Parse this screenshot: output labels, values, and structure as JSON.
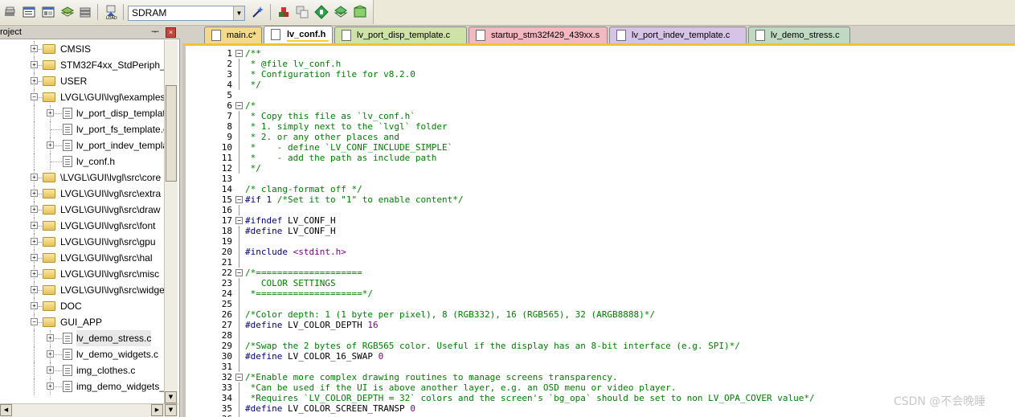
{
  "toolbar": {
    "target_select": "SDRAM",
    "icons": [
      "book-stack-icon",
      "window-icon",
      "window-list-icon",
      "layers-icon",
      "stack-icon",
      "load-icon",
      "wand-icon",
      "options-icon",
      "copy-icon",
      "diamond-icon",
      "manage-icon",
      "box-icon"
    ]
  },
  "project": {
    "title": "roject",
    "pin": "ᅮ",
    "close": "×",
    "tree": [
      {
        "type": "folder",
        "label": "CMSIS",
        "depth": 0
      },
      {
        "type": "folder",
        "label": "STM32F4xx_StdPeriph_D",
        "depth": 0
      },
      {
        "type": "folder",
        "label": "USER",
        "depth": 0
      },
      {
        "type": "folder-open",
        "label": "LVGL\\GUI\\lvgl\\examples",
        "depth": 0
      },
      {
        "type": "file",
        "label": "lv_port_disp_templat",
        "depth": 1,
        "expand": true
      },
      {
        "type": "file",
        "label": "lv_port_fs_template.c",
        "depth": 1,
        "expand": false
      },
      {
        "type": "file",
        "label": "lv_port_indev_templa",
        "depth": 1,
        "expand": true
      },
      {
        "type": "file",
        "label": "lv_conf.h",
        "depth": 1,
        "expand": false
      },
      {
        "type": "folder",
        "label": "\\LVGL\\GUI\\lvgl\\src\\core",
        "depth": 0
      },
      {
        "type": "folder",
        "label": "LVGL\\GUI\\lvgl\\src\\extra",
        "depth": 0
      },
      {
        "type": "folder",
        "label": "LVGL\\GUI\\lvgl\\src\\draw",
        "depth": 0
      },
      {
        "type": "folder",
        "label": "LVGL\\GUI\\lvgl\\src\\font",
        "depth": 0
      },
      {
        "type": "folder",
        "label": "LVGL\\GUI\\lvgl\\src\\gpu",
        "depth": 0
      },
      {
        "type": "folder",
        "label": "LVGL\\GUI\\lvgl\\src\\hal",
        "depth": 0
      },
      {
        "type": "folder",
        "label": "LVGL\\GUI\\lvgl\\src\\misc",
        "depth": 0
      },
      {
        "type": "folder",
        "label": "LVGL\\GUI\\lvgl\\src\\widge",
        "depth": 0
      },
      {
        "type": "folder",
        "label": "DOC",
        "depth": 0
      },
      {
        "type": "folder-open",
        "label": "GUI_APP",
        "depth": 0
      },
      {
        "type": "file",
        "label": "lv_demo_stress.c",
        "depth": 1,
        "expand": true,
        "selected": true
      },
      {
        "type": "file",
        "label": "lv_demo_widgets.c",
        "depth": 1,
        "expand": true
      },
      {
        "type": "file",
        "label": "img_clothes.c",
        "depth": 1,
        "expand": true
      },
      {
        "type": "file",
        "label": "img_demo_widgets_",
        "depth": 1,
        "expand": true
      }
    ]
  },
  "tabs": [
    {
      "label": "main.c*",
      "color": "#f3d98a",
      "active": false
    },
    {
      "label": "lv_conf.h",
      "color": "#ffffff",
      "active": true
    },
    {
      "label": "lv_port_disp_template.c",
      "color": "#cfe2a8",
      "active": false
    },
    {
      "label": "startup_stm32f429_439xx.s",
      "color": "#f3b9c0",
      "active": false
    },
    {
      "label": "lv_port_indev_template.c",
      "color": "#d6c3e6",
      "active": false
    },
    {
      "label": "lv_demo_stress.c",
      "color": "#bfd9c2",
      "active": false
    }
  ],
  "code": [
    {
      "n": "1",
      "fold": "-",
      "segs": [
        [
          "cm",
          "/**"
        ]
      ]
    },
    {
      "n": "2",
      "segs": [
        [
          "cm",
          " * @file lv_conf.h"
        ]
      ]
    },
    {
      "n": "3",
      "segs": [
        [
          "cm",
          " * Configuration file for v8.2.0"
        ]
      ]
    },
    {
      "n": "4",
      "segs": [
        [
          "cm",
          " */"
        ]
      ]
    },
    {
      "n": "5",
      "segs": []
    },
    {
      "n": "6",
      "fold": "-",
      "segs": [
        [
          "cm",
          "/*"
        ]
      ]
    },
    {
      "n": "7",
      "segs": [
        [
          "cm",
          " * Copy this file as `lv_conf.h`"
        ]
      ]
    },
    {
      "n": "8",
      "segs": [
        [
          "cm",
          " * 1. simply next to the `lvgl` folder"
        ]
      ]
    },
    {
      "n": "9",
      "segs": [
        [
          "cm",
          " * 2. or any other places and"
        ]
      ]
    },
    {
      "n": "10",
      "segs": [
        [
          "cm",
          " *    - define `LV_CONF_INCLUDE_SIMPLE`"
        ]
      ]
    },
    {
      "n": "11",
      "segs": [
        [
          "cm",
          " *    - add the path as include path"
        ]
      ]
    },
    {
      "n": "12",
      "segs": [
        [
          "cm",
          " */"
        ]
      ]
    },
    {
      "n": "13",
      "segs": []
    },
    {
      "n": "14",
      "segs": [
        [
          "cm",
          "/* clang-format off */"
        ]
      ]
    },
    {
      "n": "15",
      "fold": "-",
      "segs": [
        [
          "pp",
          "#if 1 "
        ],
        [
          "cm",
          "/*Set it to \"1\" to enable content*/"
        ]
      ]
    },
    {
      "n": "16",
      "segs": []
    },
    {
      "n": "17",
      "fold": "-",
      "segs": [
        [
          "pp",
          "#ifndef "
        ],
        [
          "tx",
          "LV_CONF_H"
        ]
      ]
    },
    {
      "n": "18",
      "segs": [
        [
          "pp",
          "#define "
        ],
        [
          "tx",
          "LV_CONF_H"
        ]
      ]
    },
    {
      "n": "19",
      "segs": []
    },
    {
      "n": "20",
      "segs": [
        [
          "pp",
          "#include "
        ],
        [
          "str",
          "<stdint.h>"
        ]
      ]
    },
    {
      "n": "21",
      "segs": []
    },
    {
      "n": "22",
      "fold": "-",
      "segs": [
        [
          "cm",
          "/*===================="
        ]
      ]
    },
    {
      "n": "23",
      "segs": [
        [
          "cm",
          "   COLOR SETTINGS"
        ]
      ]
    },
    {
      "n": "24",
      "segs": [
        [
          "cm",
          " *====================*/"
        ]
      ]
    },
    {
      "n": "25",
      "segs": []
    },
    {
      "n": "26",
      "segs": [
        [
          "cm",
          "/*Color depth: 1 (1 byte per pixel), 8 (RGB332), 16 (RGB565), 32 (ARGB8888)*/"
        ]
      ]
    },
    {
      "n": "27",
      "segs": [
        [
          "pp",
          "#define "
        ],
        [
          "tx",
          "LV_COLOR_DEPTH "
        ],
        [
          "num",
          "16"
        ]
      ]
    },
    {
      "n": "28",
      "segs": []
    },
    {
      "n": "29",
      "segs": [
        [
          "cm",
          "/*Swap the 2 bytes of RGB565 color. Useful if the display has an 8-bit interface (e.g. SPI)*/"
        ]
      ]
    },
    {
      "n": "30",
      "segs": [
        [
          "pp",
          "#define "
        ],
        [
          "tx",
          "LV_COLOR_16_SWAP "
        ],
        [
          "num",
          "0"
        ]
      ]
    },
    {
      "n": "31",
      "segs": []
    },
    {
      "n": "32",
      "fold": "-",
      "segs": [
        [
          "cm",
          "/*Enable more complex drawing routines to manage screens transparency."
        ]
      ]
    },
    {
      "n": "33",
      "segs": [
        [
          "cm",
          " *Can be used if the UI is above another layer, e.g. an OSD menu or video player."
        ]
      ]
    },
    {
      "n": "34",
      "segs": [
        [
          "cm",
          " *Requires `LV_COLOR_DEPTH = 32` colors and the screen's `bg_opa` should be set to non LV_OPA_COVER value*/"
        ]
      ]
    },
    {
      "n": "35",
      "segs": [
        [
          "pp",
          "#define "
        ],
        [
          "tx",
          "LV_COLOR_SCREEN_TRANSP "
        ],
        [
          "num",
          "0"
        ]
      ]
    },
    {
      "n": "36",
      "segs": []
    }
  ],
  "watermark": "CSDN @不会晚睡"
}
